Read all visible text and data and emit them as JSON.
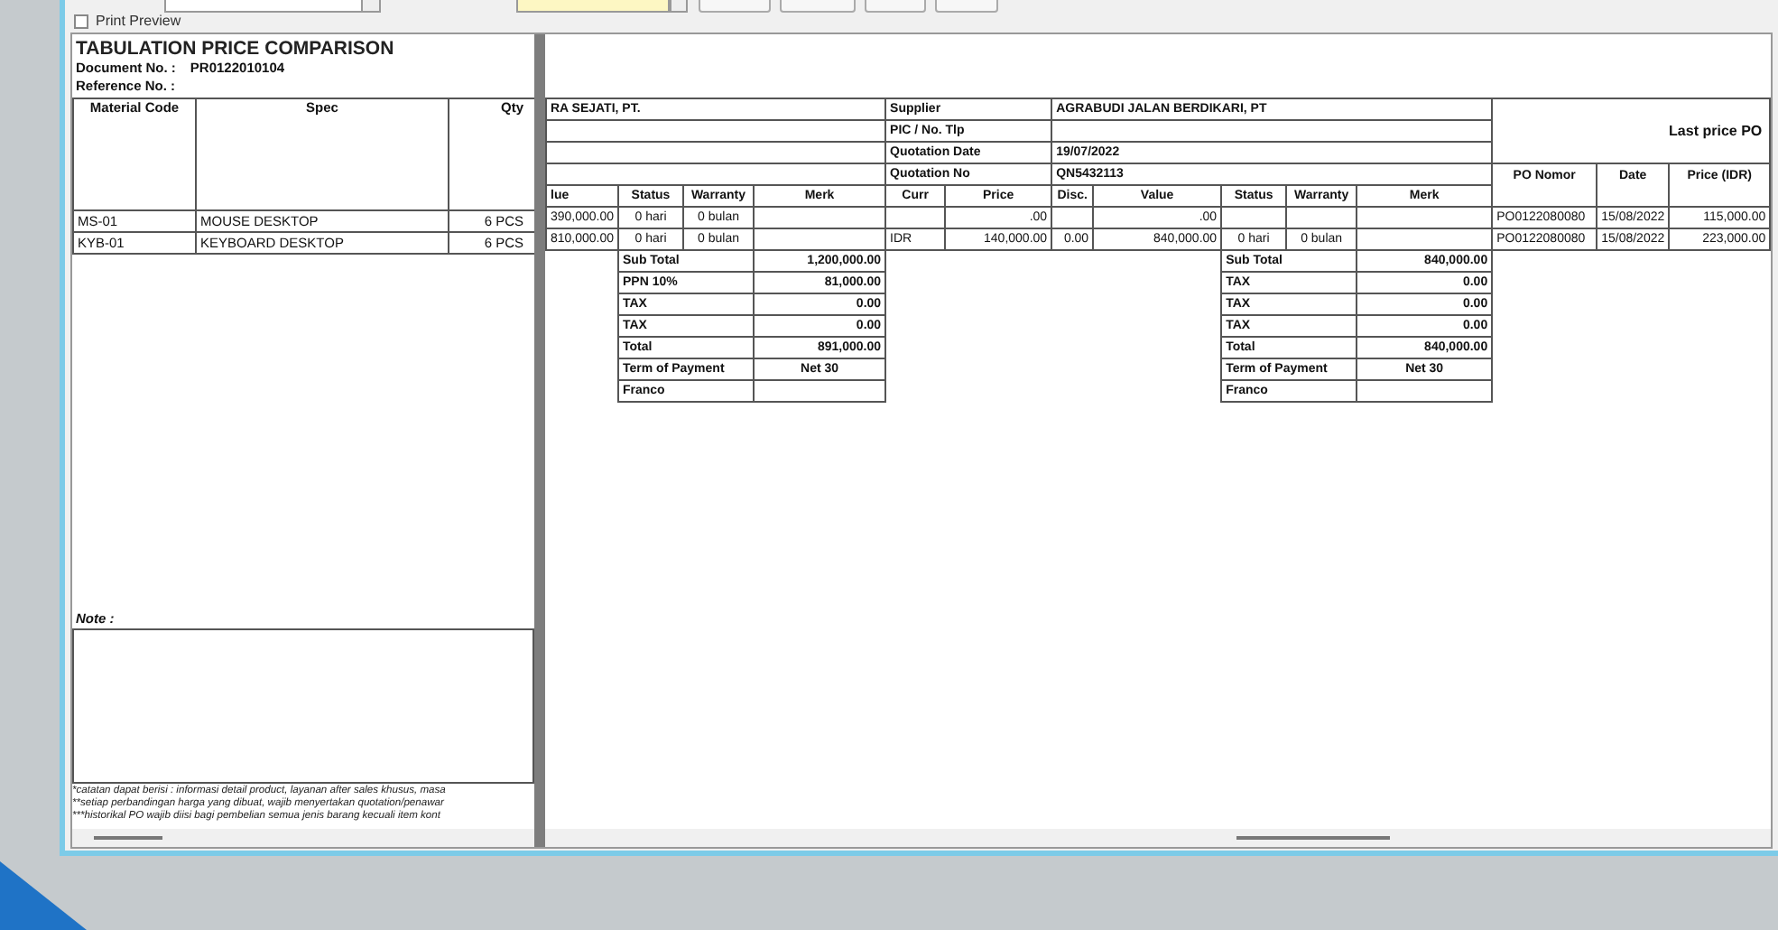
{
  "toolbar": {
    "print_preview": {
      "label": "Print Preview",
      "checked": false
    }
  },
  "report": {
    "title": "TABULATION PRICE COMPARISON",
    "document_no_label": "Document No. :",
    "document_no": "PR0122010104",
    "reference_no_label": "Reference No. :",
    "columns": [
      "Material Code",
      "Spec",
      "Qty"
    ],
    "rows": [
      {
        "material_code": "MS-01",
        "spec": "MOUSE DESKTOP",
        "qty": "6 PCS"
      },
      {
        "material_code": "KYB-01",
        "spec": "KEYBOARD DESKTOP",
        "qty": "6 PCS"
      }
    ],
    "note_label": "Note :",
    "footnotes": [
      "*catatan dapat berisi : informasi detail product, layanan after sales khusus, masa",
      "**setiap perbandingan harga yang dibuat, wajib menyertakan quotation/penawar",
      "***historikal PO wajib diisi bagi pembelian semua jenis barang kecuali item kont"
    ]
  },
  "comparison": {
    "supplier_1": {
      "name": "RA SEJATI, PT.",
      "columns": [
        "lue",
        "Status",
        "Warranty",
        "Merk"
      ],
      "rows": [
        {
          "value": "390,000.00",
          "status": "0 hari",
          "warranty": "0 bulan"
        },
        {
          "value": "810,000.00",
          "status": "0 hari",
          "warranty": "0 bulan"
        }
      ],
      "summary": [
        {
          "label": "Sub Total",
          "value": "1,200,000.00",
          "kind": "amount"
        },
        {
          "label": "PPN 10%",
          "value": "81,000.00",
          "kind": "amount"
        },
        {
          "label": "TAX",
          "value": "0.00",
          "kind": "amount"
        },
        {
          "label": "TAX",
          "value": "0.00",
          "kind": "amount"
        },
        {
          "label": "Total",
          "value": "891,000.00",
          "kind": "amount"
        },
        {
          "label": "Term of Payment",
          "value": "Net 30",
          "kind": "text"
        },
        {
          "label": "Franco",
          "kind": "text"
        }
      ]
    },
    "supplier_2": {
      "info": [
        {
          "label": "Supplier",
          "value": "AGRABUDI JALAN BERDIKARI, PT"
        },
        {
          "label": "PIC / No. Tlp"
        },
        {
          "label": "Quotation Date",
          "value": "19/07/2022"
        },
        {
          "label": "Quotation No",
          "value": "QN5432113"
        }
      ],
      "columns": [
        "Curr",
        "Price",
        "Disc.",
        "Value",
        "Status",
        "Warranty",
        "Merk"
      ],
      "rows": [
        {
          "price": ".00",
          "value": ".00"
        },
        {
          "curr": "IDR",
          "price": "140,000.00",
          "disc": "0.00",
          "value": "840,000.00",
          "status": "0 hari",
          "warranty": "0 bulan"
        }
      ],
      "summary": [
        {
          "label": "Sub Total",
          "value": "840,000.00",
          "kind": "amount"
        },
        {
          "label": "TAX",
          "value": "0.00",
          "kind": "amount"
        },
        {
          "label": "TAX",
          "value": "0.00",
          "kind": "amount"
        },
        {
          "label": "TAX",
          "value": "0.00",
          "kind": "amount"
        },
        {
          "label": "Total",
          "value": "840,000.00",
          "kind": "amount"
        },
        {
          "label": "Term of Payment",
          "value": "Net 30",
          "kind": "text"
        },
        {
          "label": "Franco",
          "kind": "text"
        }
      ]
    },
    "last_price_po": {
      "title": "Last price PO",
      "columns": [
        "PO Nomor",
        "Date",
        "Price (IDR)"
      ],
      "rows": [
        {
          "po": "PO0122080080",
          "date": "15/08/2022",
          "price": "115,000.00"
        },
        {
          "po": "PO0122080080",
          "date": "15/08/2022",
          "price": "223,000.00"
        }
      ]
    }
  }
}
